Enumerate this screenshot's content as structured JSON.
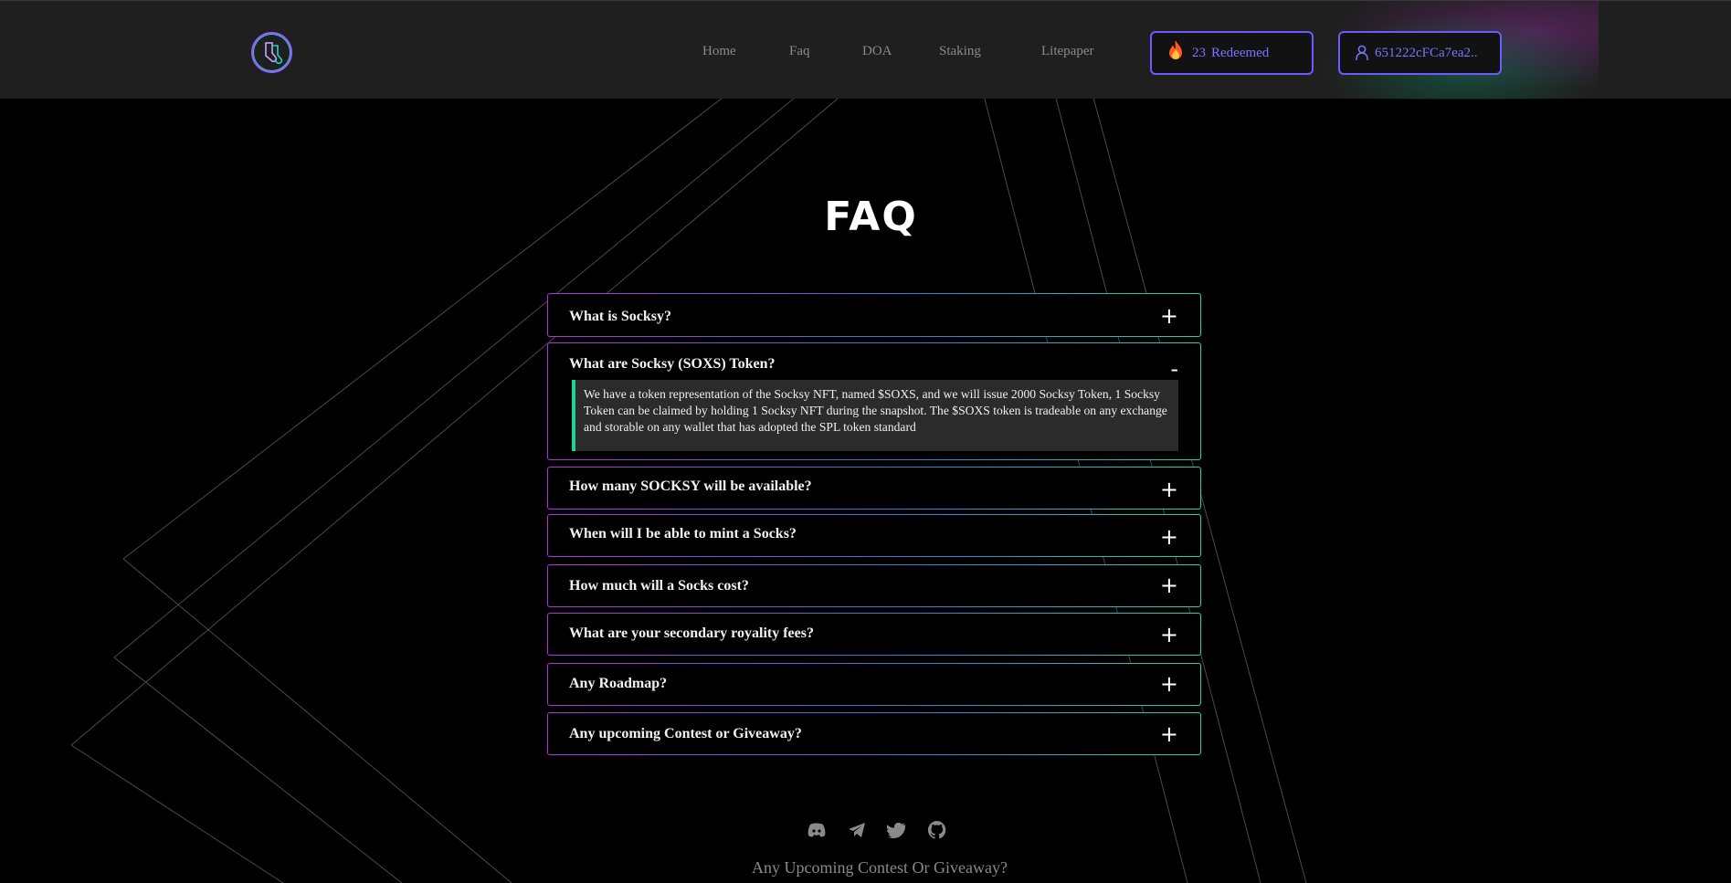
{
  "header": {
    "logo_icon": "socks-logo-icon",
    "nav": [
      {
        "label": "Home"
      },
      {
        "label": "Faq"
      },
      {
        "label": "DOA"
      },
      {
        "label": "Staking"
      },
      {
        "label": "Litepaper"
      }
    ],
    "redeemed": {
      "count": "23",
      "label": "Redeemed",
      "icon": "flame-icon"
    },
    "wallet": {
      "address": "651222cFCa7ea2..",
      "icon": "user-icon"
    }
  },
  "page": {
    "title": "FAQ"
  },
  "faq": [
    {
      "question": "What is Socksy?",
      "sign": "+",
      "expanded": false
    },
    {
      "question": "What are Socksy (SOXS) Token?",
      "sign": "-",
      "expanded": true,
      "answer": "We have a token representation of the Socksy NFT, named $SOXS, and we will issue 2000 Socksy Token, 1 Socksy Token can be claimed by holding 1 Socksy NFT during the snapshot. The $SOXS token is tradeable on any exchange and storable on any wallet that has adopted the SPL token standard"
    },
    {
      "question": "How many SOCKSY will be available?",
      "sign": "+",
      "expanded": false
    },
    {
      "question": "When will I be able to mint a Socks?",
      "sign": "+",
      "expanded": false
    },
    {
      "question": "How much will a Socks cost?",
      "sign": "+",
      "expanded": false
    },
    {
      "question": "What are your secondary royality fees?",
      "sign": "+",
      "expanded": false
    },
    {
      "question": "Any Roadmap?",
      "sign": "+",
      "expanded": false
    },
    {
      "question": "Any upcoming Contest or Giveaway?",
      "sign": "+",
      "expanded": false
    }
  ],
  "footer": {
    "social": [
      "discord-icon",
      "telegram-icon",
      "twitter-icon",
      "github-icon"
    ],
    "text": "Any Upcoming Contest Or Giveaway?"
  },
  "colors": {
    "accent_purple": "#b42ce0",
    "accent_green": "#1fd39c",
    "button_border": "#6a5cff"
  }
}
